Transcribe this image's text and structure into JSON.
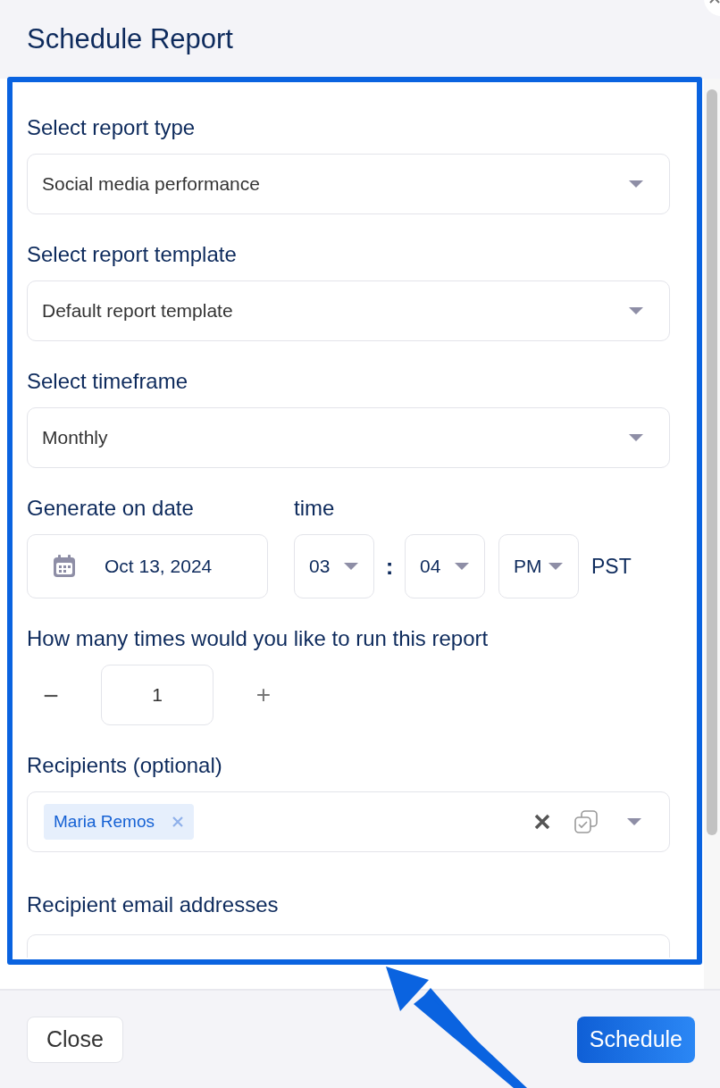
{
  "dialog": {
    "title": "Schedule Report"
  },
  "fields": [
    {
      "kind": "select",
      "label": "Select report type",
      "value": "Social media performance"
    },
    {
      "kind": "select",
      "label": "Select report template",
      "value": "Default report template"
    },
    {
      "kind": "select",
      "label": "Select timeframe",
      "value": "Monthly"
    },
    {
      "kind": "datetime",
      "label": "Generate on date",
      "time_label": "time",
      "date": "Oct 13, 2024",
      "hour": "03",
      "separator": ":",
      "minute": "04",
      "meridiem": "PM",
      "timezone": "PST"
    },
    {
      "kind": "stepper",
      "label": "How many times would you like to run this report",
      "minus": "−",
      "value": "1",
      "plus": "+"
    },
    {
      "kind": "tags",
      "label": "Recipients (optional)",
      "tags": [
        "Maria Remos"
      ]
    },
    {
      "kind": "text",
      "label": "Recipient email addresses"
    }
  ],
  "buttons": [
    {
      "label": "Close",
      "primary": false
    },
    {
      "label": "Schedule",
      "primary": true
    }
  ]
}
